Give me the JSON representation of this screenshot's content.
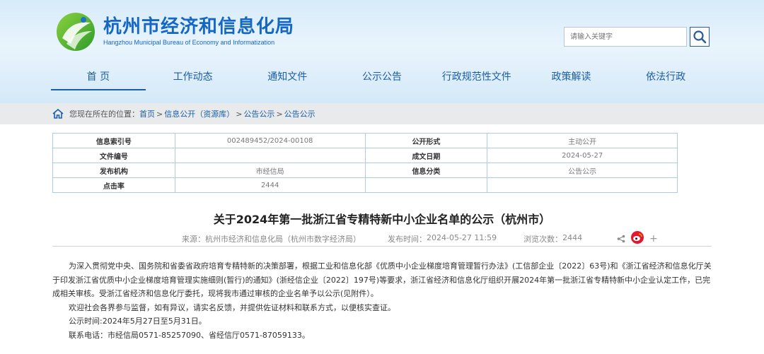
{
  "header": {
    "title": "杭州市经济和信息化局",
    "subtitle": "Hangzhou Municipal Bureau of Economy and Informatization",
    "search_placeholder": "请输入关键字"
  },
  "nav": [
    "首 页",
    "工作动态",
    "通知文件",
    "公示公告",
    "行政规范性文件",
    "政策解读",
    "依法行政"
  ],
  "breadcrumb": {
    "prefix": "您现在所在的位置：",
    "items": [
      "首页",
      "信息公开（资源库）",
      "公告公示",
      "公告公示"
    ],
    "sep": ">"
  },
  "info_table": {
    "rows": [
      [
        "信息索引号",
        "002489452/2024-00108",
        "公开形式",
        "主动公开"
      ],
      [
        "文件编号",
        "",
        "成文日期",
        "2024-05-27"
      ],
      [
        "发布机构",
        "市经信局",
        "信息分类",
        "公告公示"
      ],
      [
        "点击率",
        "2444",
        "",
        ""
      ]
    ]
  },
  "article": {
    "title": "关于2024年第一批浙江省专精特新中小企业名单的公示（杭州市）",
    "source_label": "来源：",
    "source": "杭州市经济和信息化局（杭州市数字经济局）",
    "date_label": "发布时间：",
    "date": "2024-05-27 11:59",
    "views_label": "浏览次数：",
    "views": "2444",
    "plus": "+",
    "paragraphs": [
      "为深入贯彻党中央、国务院和省委省政府培育专精特新的决策部署，根据工业和信息化部《优质中小企业梯度培育管理暂行办法》(工信部企业〔2022〕63号)和《浙江省经济和信息化厅关于印发浙江省优质中小企业梯度培育管理实施细则(暂行)的通知》(浙经信企业〔2022〕197号)等要求，浙江省经济和信息化厅组织开展2024年第一批浙江省专精特新中小企业认定工作，已完成相关审核。受浙江省经济和信息化厅委托，现将我市通过审核的企业名单予以公示(见附件）。",
      "欢迎社会各界参与监督，如有异议，请实名反馈，并提供佐证材料和联系方式，以便核实查证。",
      "公示时间:2024年5月27日至5月31日。",
      "联系电话：市经信局0571-85257090、省经信厅0571-87059133。"
    ]
  },
  "colors": {
    "brand": "#1467c4",
    "nav_text": "#1a5ea8",
    "table_border": "#aeccdf",
    "weibo": "#e6162d"
  },
  "icons": [
    "logo-icon",
    "search-icon",
    "home-icon",
    "share-icon",
    "weibo-icon",
    "plus-icon"
  ]
}
